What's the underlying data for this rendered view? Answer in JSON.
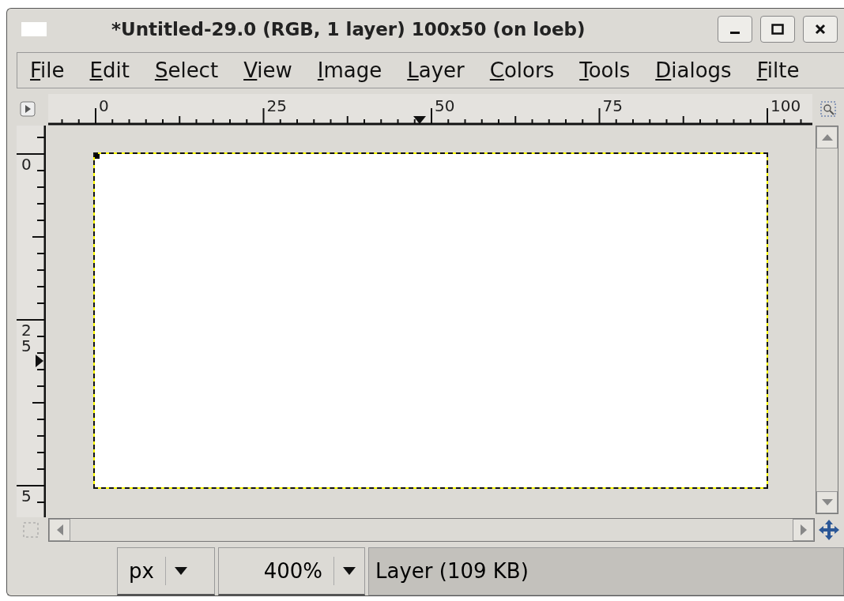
{
  "window": {
    "title": "*Untitled-29.0 (RGB, 1 layer) 100x50 (on loeb)"
  },
  "menu": [
    {
      "label": "File"
    },
    {
      "label": "Edit"
    },
    {
      "label": "Select"
    },
    {
      "label": "View"
    },
    {
      "label": "Image"
    },
    {
      "label": "Layer"
    },
    {
      "label": "Colors"
    },
    {
      "label": "Tools"
    },
    {
      "label": "Dialogs"
    },
    {
      "label": "Filte"
    }
  ],
  "ruler_horizontal": {
    "labels": [
      "0",
      "25",
      "50",
      "75",
      "100"
    ]
  },
  "ruler_vertical": {
    "labels": [
      "0",
      "25",
      "5"
    ]
  },
  "status_bar": {
    "unit": "px",
    "zoom": "400%",
    "message": "Layer (109 KB)"
  }
}
